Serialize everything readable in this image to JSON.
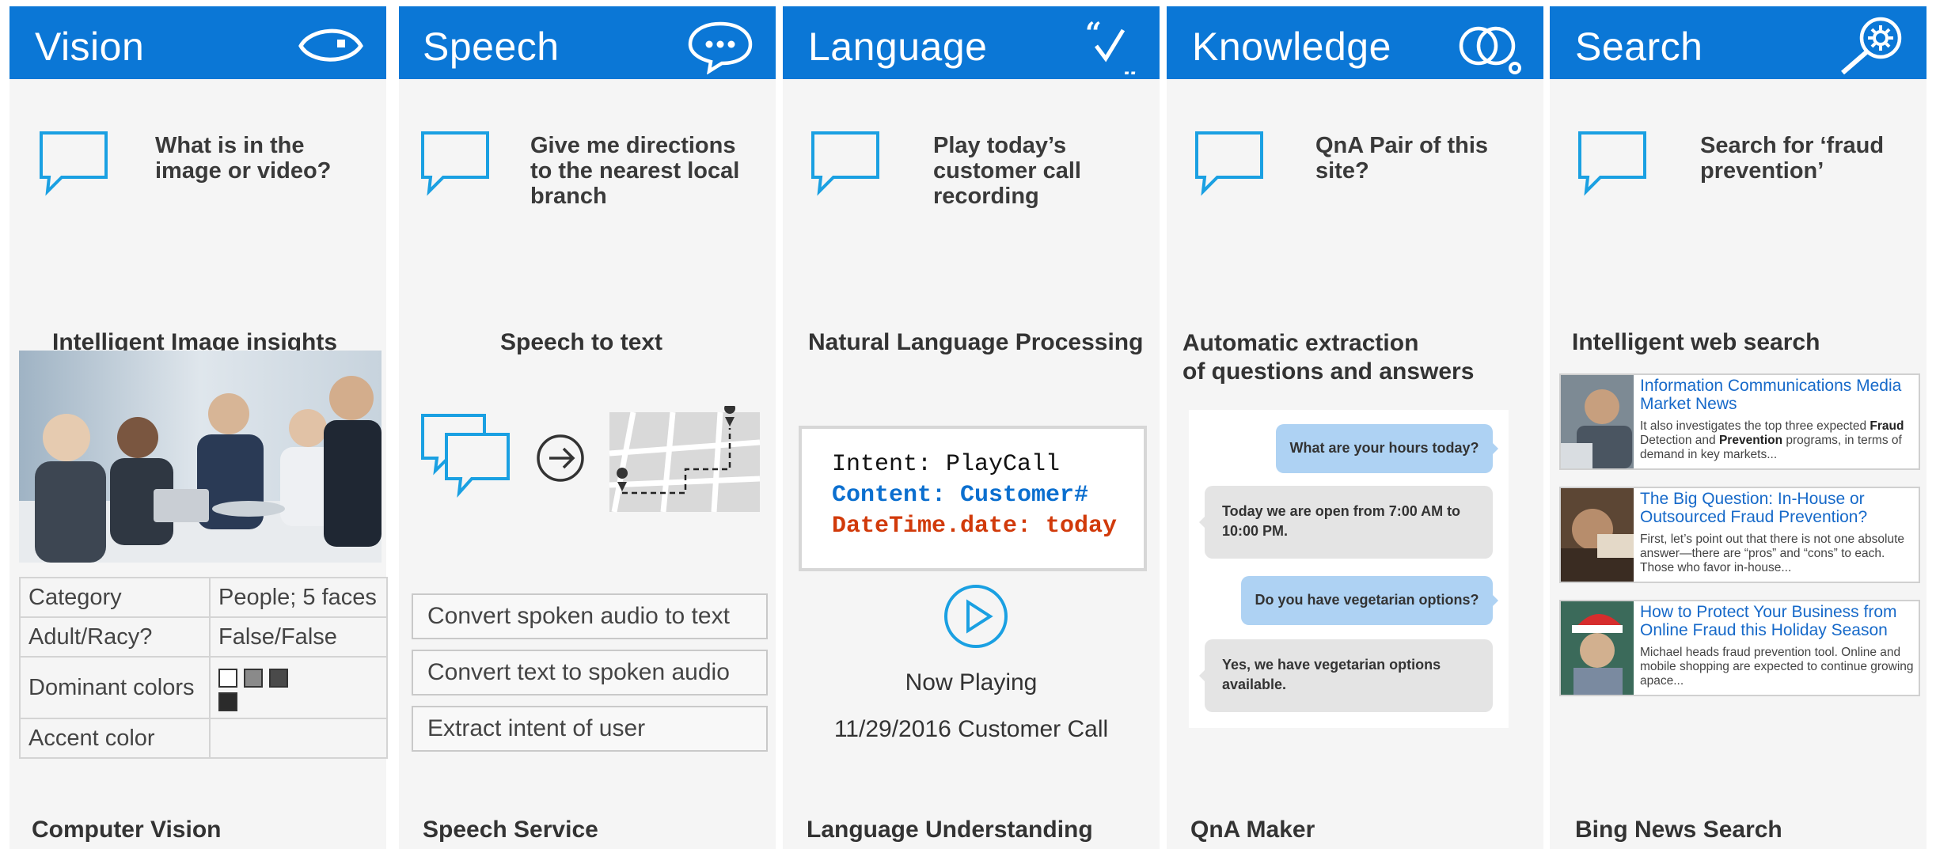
{
  "columns": {
    "vision": {
      "title": "Vision",
      "question": "What is in the image or video?",
      "section_title": "Intelligent Image insights",
      "table": {
        "category_label": "Category",
        "category_value": "People; 5 faces",
        "adult_label": "Adult/Racy?",
        "adult_value": "False/False",
        "dominant_label": "Dominant colors",
        "accent_label": "Accent color",
        "accent_value": ""
      },
      "dominant_colors": [
        "#ffffff",
        "#8a8a8a",
        "#4a4a4a",
        "#2b2b2b"
      ],
      "footer": "Computer Vision"
    },
    "speech": {
      "title": "Speech",
      "question": "Give me directions to the nearest local branch",
      "section_title": "Speech to text",
      "items": [
        "Convert spoken audio to text",
        "Convert text to spoken audio",
        "Extract intent of user"
      ],
      "footer": "Speech Service"
    },
    "language": {
      "title": "Language",
      "question": "Play today’s customer call recording",
      "section_title": "Natural Language Processing",
      "code": {
        "intent": "Intent: PlayCall",
        "content": "Content: Customer#",
        "datetime": "DateTime.date: today"
      },
      "now_playing": "Now Playing",
      "call_label": "11/29/2016 Customer Call",
      "footer": "Language Understanding"
    },
    "knowledge": {
      "title": "Knowledge",
      "question": "QnA Pair of this site?",
      "section_title_1": "Automatic extraction",
      "section_title_2": "of questions and answers",
      "chat": [
        "What are your hours today?",
        "Today we are open from 7:00 AM to 10:00 PM.",
        "Do you have vegetarian options?",
        "Yes, we have vegetarian options available."
      ],
      "footer": "QnA Maker"
    },
    "search": {
      "title": "Search",
      "question": "Search for ‘fraud prevention’",
      "section_title": "Intelligent web search",
      "results": [
        {
          "title": "Information Communications Media Market News",
          "snippet_1": "It also investigates the top three expected",
          "bold_1": "Fraud",
          "snippet_2": "Detection and",
          "bold_2": "Prevention",
          "snippet_3": "programs, in terms of demand in key markets..."
        },
        {
          "title": "The Big Question: In-House or Outsourced Fraud Prevention?",
          "snippet": "First, let’s point out that there is not one absolute answer—there are “pros” and “cons” to each. Those who favor in-house..."
        },
        {
          "title": "How to Protect Your Business from Online Fraud this Holiday Season",
          "snippet": "Michael heads fraud prevention tool. Online and mobile shopping are expected to continue growing apace..."
        }
      ],
      "footer": "Bing News Search"
    }
  },
  "colors": {
    "header_blue": "#0b77d6",
    "icon_cyan": "#1aa0e2",
    "panel_gray": "#f5f5f5"
  },
  "icons": {
    "vision": "eye-icon",
    "speech": "speech-bubble-dots-icon",
    "language": "quote-check-icon",
    "knowledge": "overlapping-circles-icon",
    "search": "magnifier-gear-icon",
    "question": "chat-bubble-icon"
  }
}
